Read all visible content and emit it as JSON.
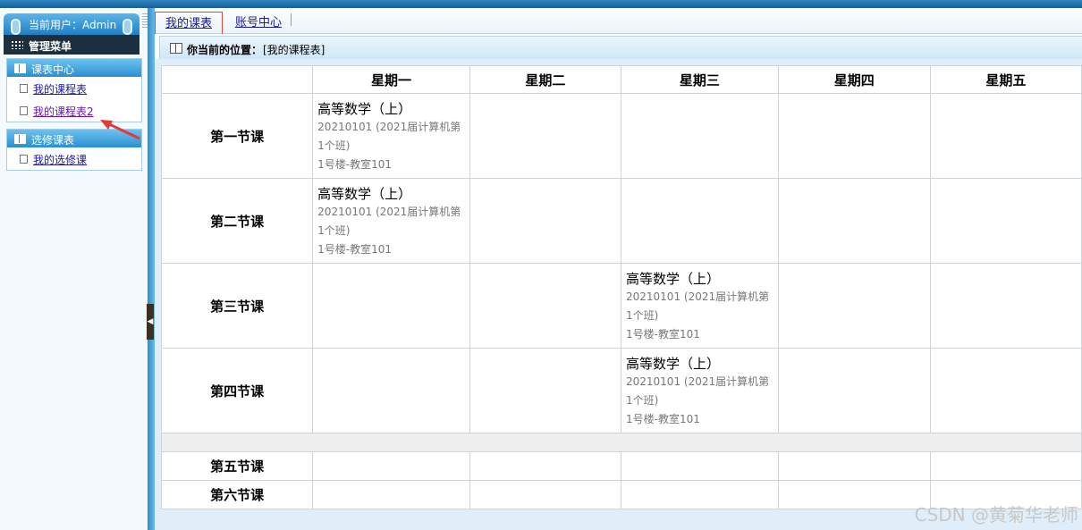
{
  "sidebar": {
    "user_label": "当前用户：Admin",
    "menu_title": "管理菜单",
    "sections": [
      {
        "title": "课表中心",
        "items": [
          {
            "label": "我的课程表"
          },
          {
            "label": "我的课程表2"
          }
        ]
      },
      {
        "title": "选修课表",
        "items": [
          {
            "label": "我的选修课"
          }
        ]
      }
    ]
  },
  "tabs": [
    {
      "label": "我的课表",
      "active": true
    },
    {
      "label": "账号中心"
    }
  ],
  "location": {
    "label": "你当前的位置：",
    "value": "[我的课程表]"
  },
  "timetable": {
    "days": [
      "星期一",
      "星期二",
      "星期三",
      "星期四",
      "星期五"
    ],
    "periods": [
      "第一节课",
      "第二节课",
      "第三节课",
      "第四节课",
      "第五节课",
      "第六节课"
    ],
    "course": {
      "name": "高等数学（上）",
      "class": "20210101 (2021届计算机第1个班)",
      "room": "1号楼-教室101"
    }
  },
  "watermark": "CSDN @黄菊华老师",
  "colors": {
    "accent_blue": "#2a8fd0",
    "menu_dark": "#1b2f3f",
    "arrow_red": "#e53935"
  }
}
